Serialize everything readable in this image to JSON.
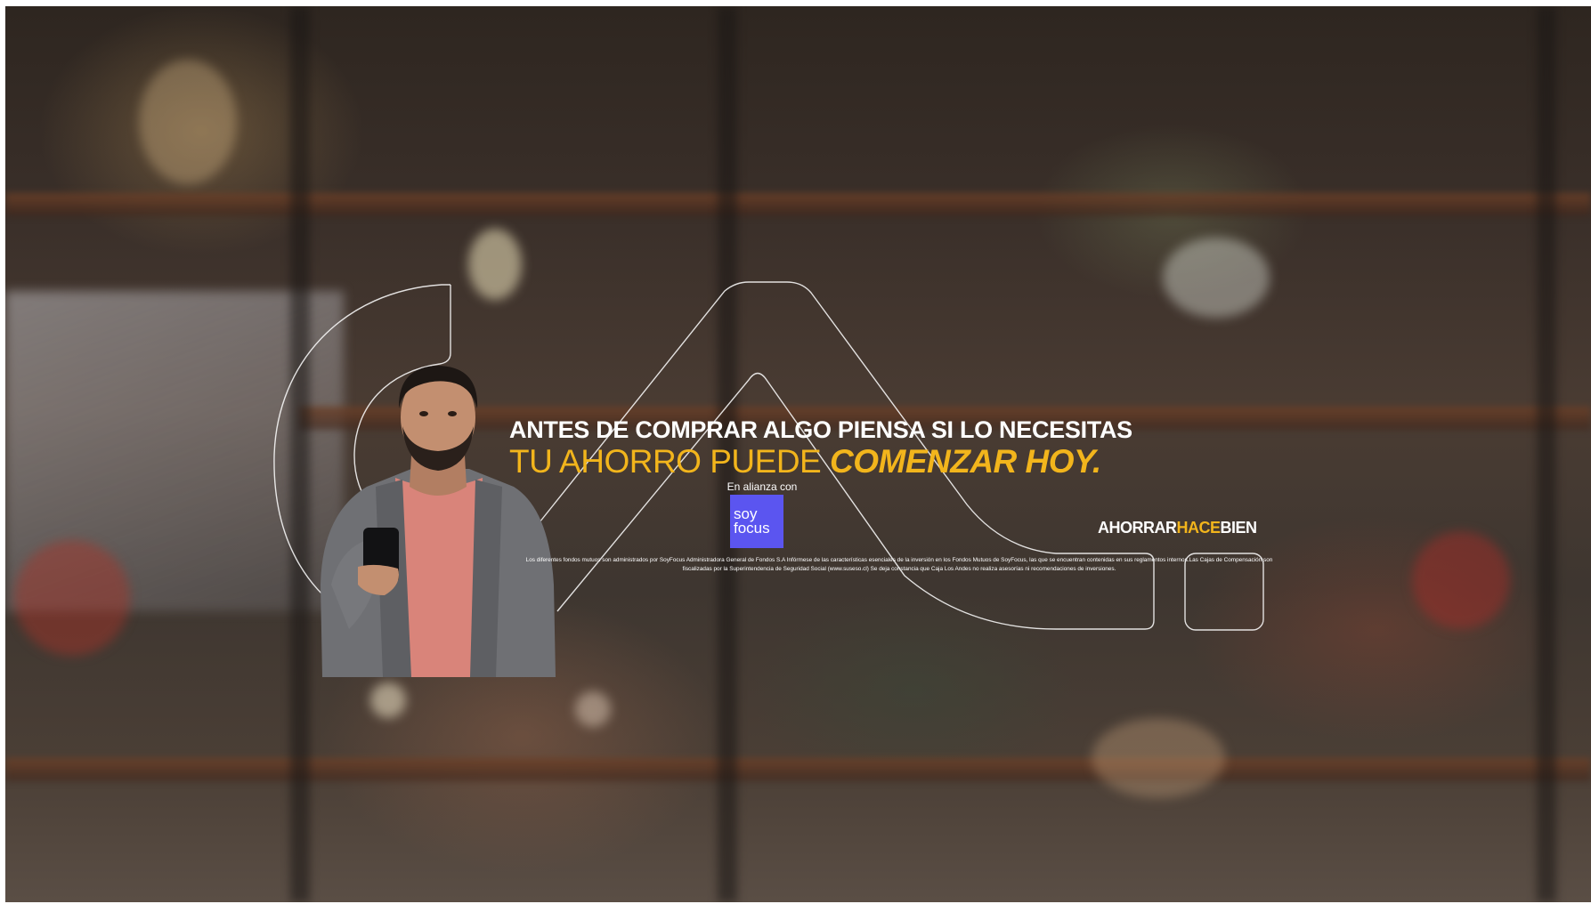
{
  "headline": {
    "line1": "ANTES DE COMPRAR ALGO PIENSA SI LO NECESITAS",
    "line2_regular": "TU AHORRO PUEDE ",
    "line2_emphasis": "COMENZAR HOY."
  },
  "partner": {
    "intro": "En alianza con",
    "logo_line1": "soy",
    "logo_line2": "focus"
  },
  "tagline": {
    "part1": "AHORRAR",
    "part2": "HACE",
    "part3": "BIEN"
  },
  "legal_text": "Los diferentes fondos mutuos son administrados por SoyFocus Administradora General de Fondos S.A Infórmese de las características esenciales de la inversión en los Fondos Mutuos de SoyFocus, las que se encuentran contenidas en sus reglamentos internos.Las Cajas de Compensación son fiscalizadas por la Superintendencia de Seguridad Social (www.suseso.cl) Se deja constancia que Caja Los Andes no realiza asesorías ni recomendaciones de inversiones.",
  "colors": {
    "accent": "#f2b51c",
    "logo_bg": "#5b55f0",
    "text": "#ffffff"
  }
}
